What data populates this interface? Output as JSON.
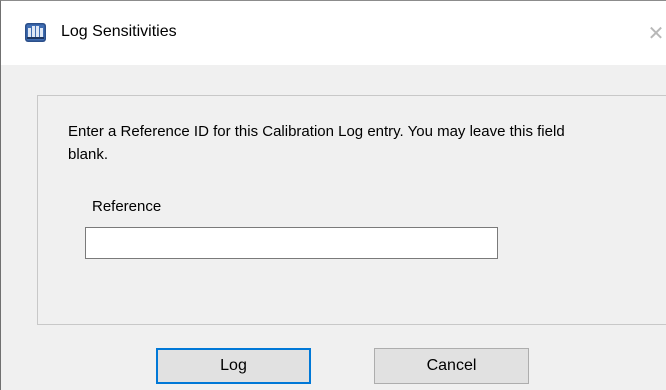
{
  "window": {
    "title": "Log Sensitivities",
    "icon": "app-icon",
    "close_glyph": "✕"
  },
  "dialog": {
    "instructions": "Enter a Reference ID for this Calibration Log entry. You may leave this field blank.",
    "reference_label": "Reference",
    "reference_value": "",
    "reference_placeholder": ""
  },
  "buttons": {
    "log_label": "Log",
    "cancel_label": "Cancel"
  },
  "colors": {
    "default_button_border": "#0078d7",
    "dialog_background": "#f0f0f0",
    "titlebar_background": "#ffffff"
  }
}
